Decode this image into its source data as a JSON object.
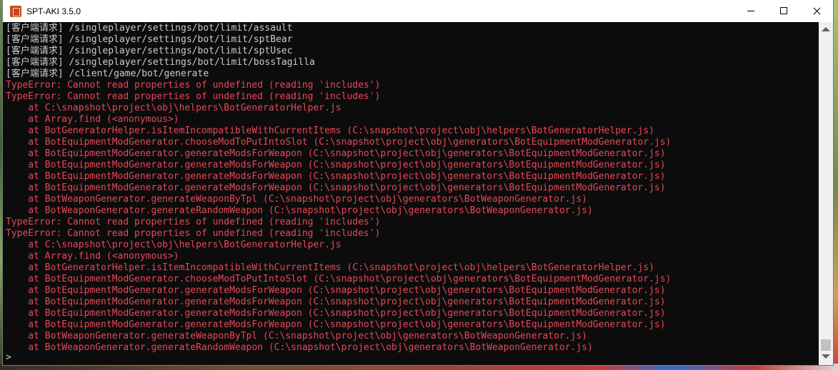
{
  "window": {
    "title": "SPT-AKI 3.5.0"
  },
  "console": {
    "lines": [
      {
        "type": "info",
        "text": "[客户端请求] /singleplayer/settings/bot/limit/assault"
      },
      {
        "type": "info",
        "text": "[客户端请求] /singleplayer/settings/bot/limit/sptBear"
      },
      {
        "type": "info",
        "text": "[客户端请求] /singleplayer/settings/bot/limit/sptUsec"
      },
      {
        "type": "info",
        "text": "[客户端请求] /singleplayer/settings/bot/limit/bossTagilla"
      },
      {
        "type": "info",
        "text": "[客户端请求] /client/game/bot/generate"
      },
      {
        "type": "error",
        "text": "TypeError: Cannot read properties of undefined (reading 'includes')"
      },
      {
        "type": "error",
        "text": "TypeError: Cannot read properties of undefined (reading 'includes')"
      },
      {
        "type": "error",
        "text": "    at C:\\snapshot\\project\\obj\\helpers\\BotGeneratorHelper.js"
      },
      {
        "type": "error",
        "text": "    at Array.find (<anonymous>)"
      },
      {
        "type": "error",
        "text": "    at BotGeneratorHelper.isItemIncompatibleWithCurrentItems (C:\\snapshot\\project\\obj\\helpers\\BotGeneratorHelper.js)"
      },
      {
        "type": "error",
        "text": "    at BotEquipmentModGenerator.chooseModToPutIntoSlot (C:\\snapshot\\project\\obj\\generators\\BotEquipmentModGenerator.js)"
      },
      {
        "type": "error",
        "text": "    at BotEquipmentModGenerator.generateModsForWeapon (C:\\snapshot\\project\\obj\\generators\\BotEquipmentModGenerator.js)"
      },
      {
        "type": "error",
        "text": "    at BotEquipmentModGenerator.generateModsForWeapon (C:\\snapshot\\project\\obj\\generators\\BotEquipmentModGenerator.js)"
      },
      {
        "type": "error",
        "text": "    at BotEquipmentModGenerator.generateModsForWeapon (C:\\snapshot\\project\\obj\\generators\\BotEquipmentModGenerator.js)"
      },
      {
        "type": "error",
        "text": "    at BotEquipmentModGenerator.generateModsForWeapon (C:\\snapshot\\project\\obj\\generators\\BotEquipmentModGenerator.js)"
      },
      {
        "type": "error",
        "text": "    at BotWeaponGenerator.generateWeaponByTpl (C:\\snapshot\\project\\obj\\generators\\BotWeaponGenerator.js)"
      },
      {
        "type": "error",
        "text": "    at BotWeaponGenerator.generateRandomWeapon (C:\\snapshot\\project\\obj\\generators\\BotWeaponGenerator.js)"
      },
      {
        "type": "error",
        "text": "TypeError: Cannot read properties of undefined (reading 'includes')"
      },
      {
        "type": "error",
        "text": "TypeError: Cannot read properties of undefined (reading 'includes')"
      },
      {
        "type": "error",
        "text": "    at C:\\snapshot\\project\\obj\\helpers\\BotGeneratorHelper.js"
      },
      {
        "type": "error",
        "text": "    at Array.find (<anonymous>)"
      },
      {
        "type": "error",
        "text": "    at BotGeneratorHelper.isItemIncompatibleWithCurrentItems (C:\\snapshot\\project\\obj\\helpers\\BotGeneratorHelper.js)"
      },
      {
        "type": "error",
        "text": "    at BotEquipmentModGenerator.chooseModToPutIntoSlot (C:\\snapshot\\project\\obj\\generators\\BotEquipmentModGenerator.js)"
      },
      {
        "type": "error",
        "text": "    at BotEquipmentModGenerator.generateModsForWeapon (C:\\snapshot\\project\\obj\\generators\\BotEquipmentModGenerator.js)"
      },
      {
        "type": "error",
        "text": "    at BotEquipmentModGenerator.generateModsForWeapon (C:\\snapshot\\project\\obj\\generators\\BotEquipmentModGenerator.js)"
      },
      {
        "type": "error",
        "text": "    at BotEquipmentModGenerator.generateModsForWeapon (C:\\snapshot\\project\\obj\\generators\\BotEquipmentModGenerator.js)"
      },
      {
        "type": "error",
        "text": "    at BotEquipmentModGenerator.generateModsForWeapon (C:\\snapshot\\project\\obj\\generators\\BotEquipmentModGenerator.js)"
      },
      {
        "type": "error",
        "text": "    at BotWeaponGenerator.generateWeaponByTpl (C:\\snapshot\\project\\obj\\generators\\BotWeaponGenerator.js)"
      },
      {
        "type": "error",
        "text": "    at BotWeaponGenerator.generateRandomWeapon (C:\\snapshot\\project\\obj\\generators\\BotWeaponGenerator.js)"
      }
    ],
    "prompt": ">"
  },
  "colors": {
    "info": "#cccccc",
    "error": "#e74856",
    "background": "#0c0c0c"
  },
  "icons": {
    "app": "app-icon",
    "minimize": "minimize-icon",
    "maximize": "maximize-icon",
    "close": "close-icon"
  }
}
